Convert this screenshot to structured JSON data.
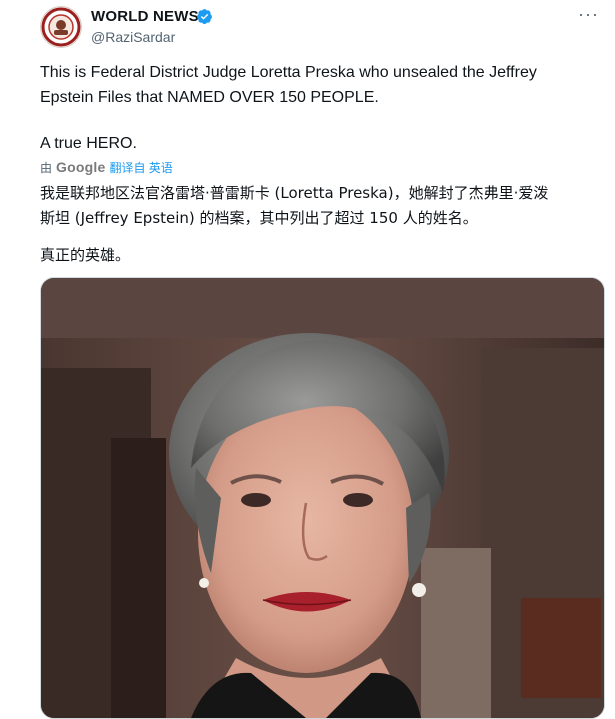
{
  "user": {
    "display_name": "WORLD NEWS",
    "handle": "@RaziSardar",
    "verified": true,
    "verified_color": "#1d9bf0"
  },
  "tweet": {
    "text_line1": "This is Federal District Judge Loretta Preska who unsealed the Jeffrey",
    "text_line2": "Epstein Files that NAMED OVER 150 PEOPLE.",
    "hero": "A true HERO."
  },
  "translation": {
    "by": "由",
    "google": "Google",
    "link": "翻译自 英语",
    "line1": "我是联邦地区法官洛雷塔·普雷斯卡 (Loretta Preska)，她解封了杰弗里·爱泼",
    "line2": "斯坦 (Jeffrey Epstein) 的档案，其中列出了超过 150 人的姓名。",
    "hero": "真正的英雄。"
  },
  "icons": {
    "more": "more-horizontal-icon",
    "verified": "verified-badge-icon",
    "translate": "google-translate-icon"
  },
  "media": {
    "type": "portrait-photo"
  }
}
